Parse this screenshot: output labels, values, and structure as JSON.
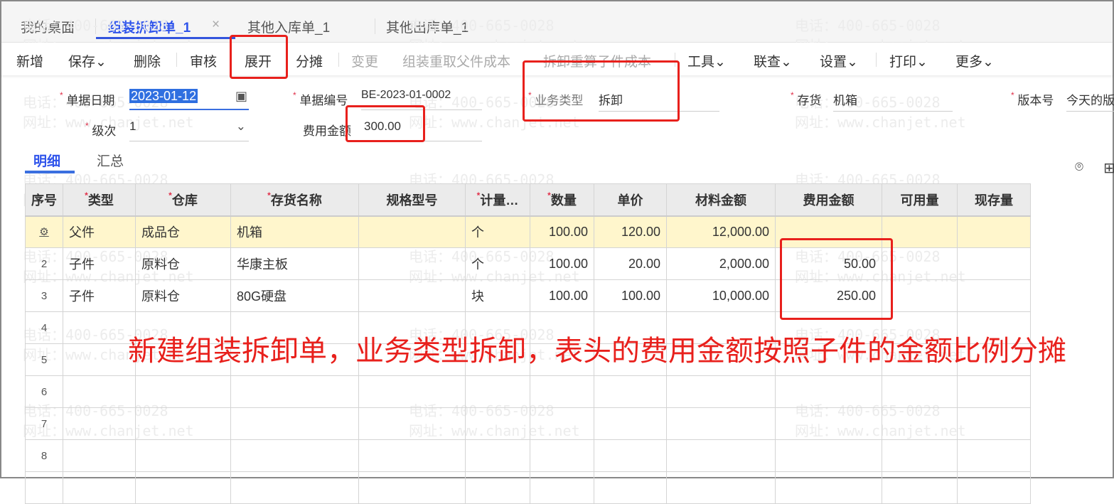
{
  "watermark": {
    "phone": "电话：400-665-0028",
    "web": "网址：www.chanjet.net"
  },
  "tabs": [
    {
      "label": "我的桌面"
    },
    {
      "label": "组装拆卸单_1",
      "close": "×"
    },
    {
      "label": "其他入库单_1"
    },
    {
      "label": "其他出库单_1"
    }
  ],
  "toolbar": {
    "new": "新增",
    "save": "保存",
    "delete": "删除",
    "audit": "审核",
    "expand": "展开",
    "allocate": "分摊",
    "change": "变更",
    "reassemble": "组装重取父件成本",
    "recalc": "拆卸重算子件成本",
    "tools": "工具",
    "query": "联查",
    "settings": "设置",
    "print": "打印",
    "more": "更多",
    "chevron": "⌄"
  },
  "form": {
    "date_label": "单据日期",
    "date_value": "2023-01-12",
    "code_label": "单据编号",
    "code_value": "BE-2023-01-0002",
    "biztype_label": "业务类型",
    "biztype_value": "拆卸",
    "inventory_label": "存货",
    "inventory_value": "机箱",
    "version_label": "版本号",
    "version_value": "今天的版本",
    "level_label": "级次",
    "level_value": "1",
    "fee_label": "费用金额",
    "fee_value": "300.00"
  },
  "subtabs": [
    "明细",
    "汇总"
  ],
  "table": {
    "headers": [
      {
        "t": "序号"
      },
      {
        "t": "类型",
        "r": true
      },
      {
        "t": "仓库",
        "r": true
      },
      {
        "t": "存货名称",
        "r": true
      },
      {
        "t": "规格型号"
      },
      {
        "t": "计量…",
        "r": true
      },
      {
        "t": "数量",
        "r": true
      },
      {
        "t": "单价"
      },
      {
        "t": "材料金额"
      },
      {
        "t": "费用金额"
      },
      {
        "t": "可用量"
      },
      {
        "t": "现存量"
      }
    ],
    "rows": [
      [
        "",
        "父件",
        "成品仓",
        "机箱",
        "",
        "个",
        "100.00",
        "120.00",
        "12,000.00",
        "",
        "",
        ""
      ],
      [
        "2",
        "子件",
        "原料仓",
        "华康主板",
        "",
        "个",
        "100.00",
        "20.00",
        "2,000.00",
        "50.00",
        "",
        ""
      ],
      [
        "3",
        "子件",
        "原料仓",
        "80G硬盘",
        "",
        "块",
        "100.00",
        "100.00",
        "10,000.00",
        "250.00",
        "",
        ""
      ],
      [
        "4",
        "",
        "",
        "",
        "",
        "",
        "",
        "",
        "",
        "",
        "",
        ""
      ],
      [
        "5",
        "",
        "",
        "",
        "",
        "",
        "",
        "",
        "",
        "",
        "",
        ""
      ],
      [
        "6",
        "",
        "",
        "",
        "",
        "",
        "",
        "",
        "",
        "",
        "",
        ""
      ],
      [
        "7",
        "",
        "",
        "",
        "",
        "",
        "",
        "",
        "",
        "",
        "",
        ""
      ],
      [
        "8",
        "",
        "",
        "",
        "",
        "",
        "",
        "",
        "",
        "",
        "",
        ""
      ],
      [
        "",
        "",
        "",
        "",
        "",
        "",
        "",
        "",
        "",
        "",
        "",
        ""
      ]
    ]
  },
  "annotation": "新建组装拆卸单，业务类型拆卸，表头的费用金额按照子件的金额比例分摊"
}
